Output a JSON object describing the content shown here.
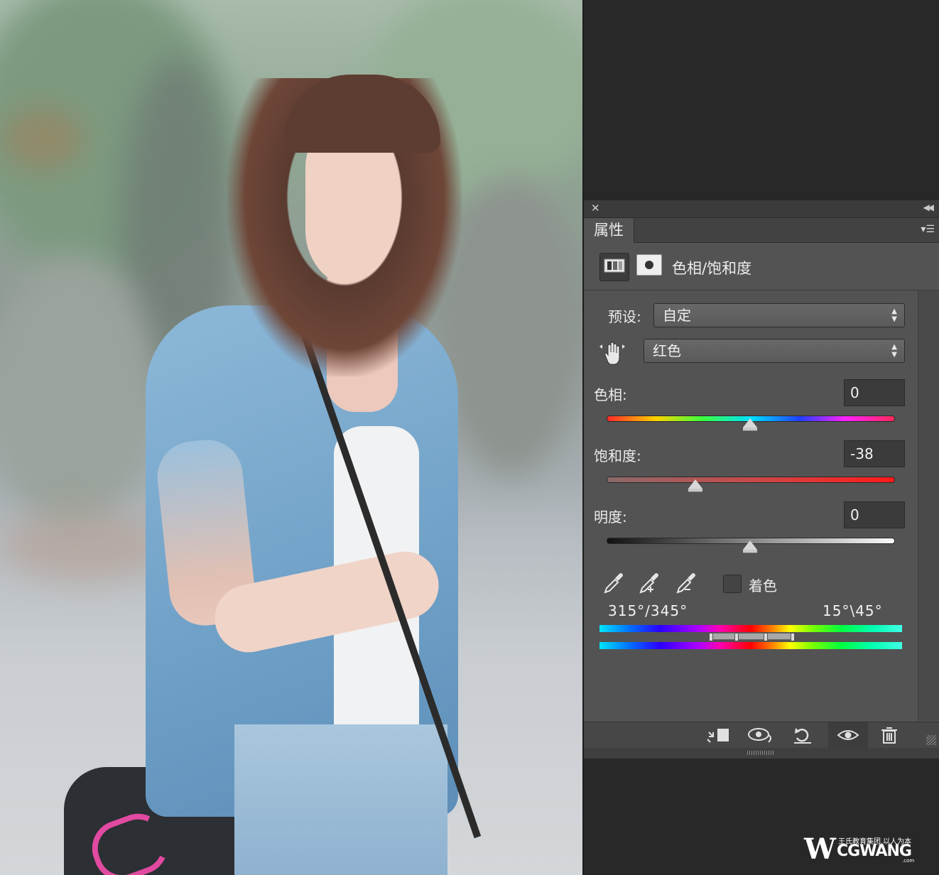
{
  "panel": {
    "tab_label": "属性",
    "adjustment_title": "色相/饱和度",
    "preset": {
      "label": "预设:",
      "value": "自定"
    },
    "channel": {
      "value": "红色"
    },
    "hue": {
      "label": "色相:",
      "value": "0"
    },
    "saturation": {
      "label": "饱和度:",
      "value": "-38"
    },
    "lightness": {
      "label": "明度:",
      "value": "0"
    },
    "colorize": {
      "label": "着色",
      "checked": false
    },
    "range_left": "315°/345°",
    "range_right": "15°\\45°",
    "icons": {
      "close": "close-icon",
      "collapse": "double-chevron-left-icon",
      "panel_menu": "panel-menu-icon",
      "target_adjust": "hand-scrub-icon",
      "eyedropper": "eyedropper-icon",
      "eyedropper_add": "eyedropper-plus-icon",
      "eyedropper_sub": "eyedropper-minus-icon",
      "clip": "clip-to-layer-icon",
      "view_previous": "view-previous-icon",
      "reset": "reset-icon",
      "visibility": "eye-icon",
      "delete": "trash-icon"
    }
  },
  "watermark": {
    "tagline": "王氏教育集团,以人为本",
    "brand": "CGWANG",
    "suffix": ".com"
  }
}
